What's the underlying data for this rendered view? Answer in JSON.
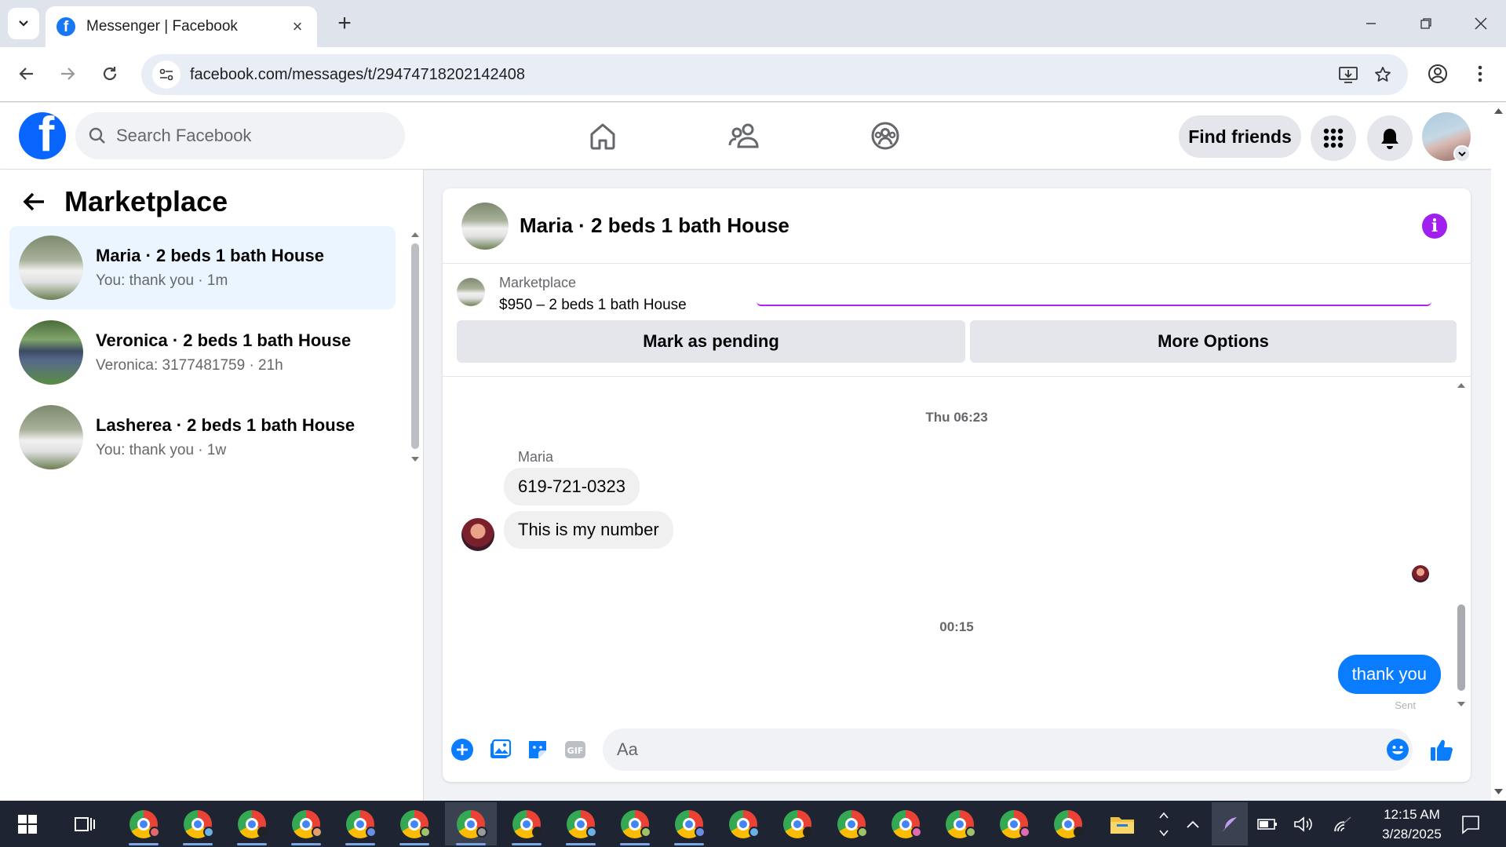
{
  "browser": {
    "tab_title": "Messenger | Facebook",
    "tab_close": "×",
    "new_tab": "+",
    "url": "facebook.com/messages/t/29474718202142408"
  },
  "fb_header": {
    "logo": "f",
    "search_placeholder": "Search Facebook",
    "find_friends_label": "Find friends"
  },
  "sidebar": {
    "title": "Marketplace",
    "conversations": [
      {
        "name": "Maria · 2 beds 1 bath House",
        "preview": "You: thank you · 1m",
        "active": true
      },
      {
        "name": "Veronica · 2 beds 1 bath House",
        "preview": "Veronica: 3177481759 · 21h",
        "active": false
      },
      {
        "name": "Lasherea · 2 beds 1 bath House",
        "preview": "You: thank you · 1w",
        "active": false
      }
    ]
  },
  "chat": {
    "title": "Maria · 2 beds 1 bath House",
    "info_icon": "i",
    "listing": {
      "label": "Marketplace",
      "price_title": "$950 – 2 beds 1 bath House",
      "mark_pending": "Mark as pending",
      "more_options": "More Options"
    },
    "messages": {
      "timestamp_1": "Thu 06:23",
      "sender": "Maria",
      "incoming_1": "619-721-0323",
      "incoming_2": "This is my number",
      "timestamp_2": "00:15",
      "outgoing_1": "thank you",
      "status": "Sent"
    },
    "composer_placeholder": "Aa"
  },
  "taskbar": {
    "time": "12:15 AM",
    "date": "3/28/2025"
  },
  "colors": {
    "fb_blue": "#0866ff",
    "messenger_blue": "#0a7cff",
    "info_purple": "#a020f0",
    "active_conv": "#ebf5ff"
  }
}
